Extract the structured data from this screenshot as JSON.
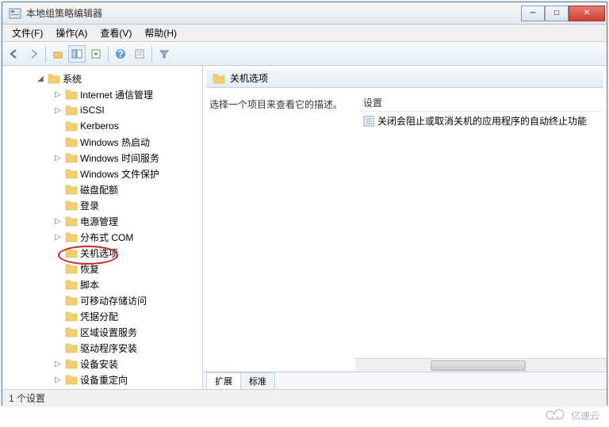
{
  "window": {
    "title": "本地组策略编辑器"
  },
  "menu": {
    "file": "文件(F)",
    "action": "操作(A)",
    "view": "查看(V)",
    "help": "帮助(H)"
  },
  "tree": {
    "root": "系统",
    "items": [
      {
        "label": "Internet 通信管理",
        "expandable": true
      },
      {
        "label": "iSCSI",
        "expandable": true
      },
      {
        "label": "Kerberos",
        "expandable": false
      },
      {
        "label": "Windows 热启动",
        "expandable": false
      },
      {
        "label": "Windows 时间服务",
        "expandable": true
      },
      {
        "label": "Windows 文件保护",
        "expandable": false
      },
      {
        "label": "磁盘配额",
        "expandable": false
      },
      {
        "label": "登录",
        "expandable": false
      },
      {
        "label": "电源管理",
        "expandable": true
      },
      {
        "label": "分布式 COM",
        "expandable": true
      },
      {
        "label": "关机选项",
        "expandable": false,
        "highlighted": true
      },
      {
        "label": "恢复",
        "expandable": false
      },
      {
        "label": "脚本",
        "expandable": false
      },
      {
        "label": "可移动存储访问",
        "expandable": false
      },
      {
        "label": "凭据分配",
        "expandable": false
      },
      {
        "label": "区域设置服务",
        "expandable": false
      },
      {
        "label": "驱动程序安装",
        "expandable": false
      },
      {
        "label": "设备安装",
        "expandable": true
      },
      {
        "label": "设备重定向",
        "expandable": true
      }
    ]
  },
  "right": {
    "title": "关机选项",
    "description": "选择一个项目来查看它的描述。",
    "columns": {
      "settings": "设置"
    },
    "rows": [
      {
        "label": "关闭会阻止或取消关机的应用程序的自动终止功能"
      }
    ]
  },
  "tabs": {
    "extended": "扩展",
    "standard": "标准"
  },
  "status": {
    "text": "1 个设置"
  },
  "watermark": "亿速云"
}
